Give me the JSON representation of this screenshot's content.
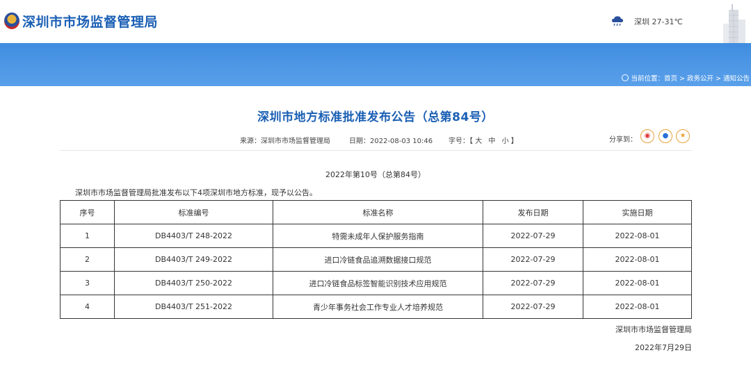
{
  "header": {
    "site_title": "深圳市市场监督管理局",
    "weather": "深圳 27-31℃",
    "breadcrumb": "当前位置：首页 > 政务公开 > 通知公告"
  },
  "article": {
    "title": "深圳市地方标准批准发布公告（总第84号）",
    "source": "来源：深圳市市场监督管理局",
    "date": "日期：2022-08-03 10:46",
    "font_size_label": "字号：【",
    "font_large": "大",
    "font_medium": "中",
    "font_small": "小",
    "font_size_end": "】",
    "share_label": "分享到：",
    "issue": "2022年第10号（总第84号）",
    "intro": "深圳市市场监督管理局批准发布以下4项深圳市地方标准，现予以公告。",
    "signature": "深圳市市场监督管理局",
    "sign_date": "2022年7月29日"
  },
  "table": {
    "headers": [
      "序号",
      "标准编号",
      "标准名称",
      "发布日期",
      "实施日期"
    ],
    "rows": [
      [
        "1",
        "DB4403/T 248-2022",
        "特需未成年人保护服务指南",
        "2022-07-29",
        "2022-08-01"
      ],
      [
        "2",
        "DB4403/T 249-2022",
        "进口冷链食品追溯数据接口规范",
        "2022-07-29",
        "2022-08-01"
      ],
      [
        "3",
        "DB4403/T 250-2022",
        "进口冷链食品标签智能识别技术应用规范",
        "2022-07-29",
        "2022-08-01"
      ],
      [
        "4",
        "DB4403/T 251-2022",
        "青少年事务社会工作专业人才培养规范",
        "2022-07-29",
        "2022-08-01"
      ]
    ]
  },
  "colors": {
    "brand_blue": "#1a5fb4",
    "banner": "#4a94e4",
    "share_accent": "#e8a23a"
  },
  "icons": [
    "emblem-icon",
    "weather-icon",
    "building-icon",
    "location-icon",
    "weibo-icon",
    "qq-icon",
    "qzone-icon"
  ]
}
